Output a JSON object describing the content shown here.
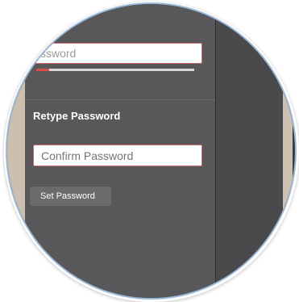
{
  "form": {
    "password": {
      "placeholder": "Password",
      "visible_text": "ssword"
    },
    "strength": {
      "level": 0.08,
      "color": "#d94c4c"
    },
    "retype_label": "Retype Password",
    "confirm": {
      "placeholder": "Confirm Password"
    },
    "submit_label": "Set Password"
  }
}
